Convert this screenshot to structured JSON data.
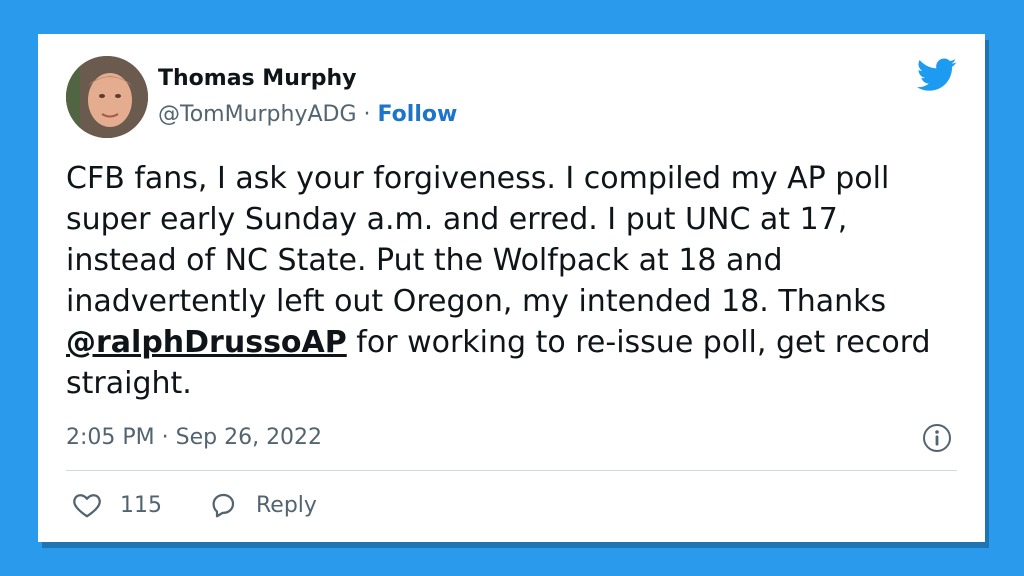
{
  "author": {
    "name": "Thomas Murphy",
    "handle": "@TomMurphyADG",
    "separator": "·",
    "follow_label": "Follow"
  },
  "tweet": {
    "text_before": "CFB fans, I ask your forgiveness. I compiled my AP poll super early Sunday a.m. and erred. I put UNC at 17, instead of NC State. Put the Wolfpack at 18 and inadvertently left out Oregon, my intended 18. Thanks ",
    "mention": "@ralphDrussoAP",
    "text_after": " for working to re-issue poll, get record straight.",
    "timestamp": "2:05 PM · Sep 26, 2022"
  },
  "actions": {
    "like_count": "115",
    "reply_label": "Reply"
  },
  "icons": {
    "logo": "twitter-bird-icon",
    "info": "info-icon",
    "like": "heart-icon",
    "reply": "speech-bubble-icon"
  },
  "colors": {
    "background": "#2a9bec",
    "brand_blue": "#1d9bf0",
    "follow_blue": "#1d74c8",
    "text": "#0f1419",
    "muted": "#536471"
  }
}
